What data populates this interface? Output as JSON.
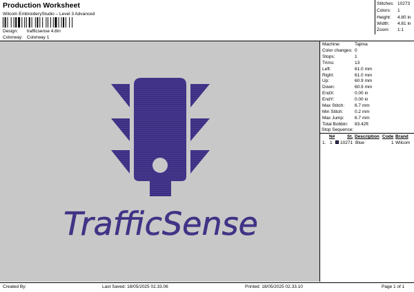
{
  "header": {
    "title": "Production Worksheet",
    "subtitle": "Wilcom EmbroideryStudio – Level 3 Advanced",
    "design_label": "Design:",
    "design_value": "trafficsense 4.8in",
    "colorway_label": "Colorway:",
    "colorway_value": "Colorway 1"
  },
  "summary": {
    "stitches_label": "Stitches:",
    "stitches_value": "10273",
    "colors_label": "Colors:",
    "colors_value": "1",
    "height_label": "Height:",
    "height_value": "4.80 in",
    "width_label": "Width:",
    "width_value": "4.81 in",
    "zoom_label": "Zoom:",
    "zoom_value": "1:1"
  },
  "design_preview": {
    "logo_text": "TrafficSense",
    "thread_color": "#3d2f80"
  },
  "machine_info": [
    {
      "label": "Machine:",
      "value": "Tajima"
    },
    {
      "label": "Color changes:",
      "value": "0"
    },
    {
      "label": "Stops:",
      "value": "1"
    },
    {
      "label": "Trims:",
      "value": "13"
    },
    {
      "label": "Left:",
      "value": "61.0 mm"
    },
    {
      "label": "Right:",
      "value": "61.0 mm"
    },
    {
      "label": "Up:",
      "value": "60.9 mm"
    },
    {
      "label": "Down:",
      "value": "60.9 mm"
    },
    {
      "label": "EndX:",
      "value": "0.00 in"
    },
    {
      "label": "EndY:",
      "value": "0.00 in"
    },
    {
      "label": "Max Stitch:",
      "value": "6.7 mm"
    },
    {
      "label": "Min Stitch:",
      "value": "0.2 mm"
    },
    {
      "label": "Max Jump:",
      "value": "6.7 mm"
    },
    {
      "label": "Total Bobbin:",
      "value": "83.42ft"
    }
  ],
  "stop_sequence": {
    "heading": "Stop Sequence:",
    "columns": [
      "N#",
      "St.",
      "Description",
      "Code",
      "Brand"
    ],
    "rows": [
      {
        "index": "1.",
        "n": "1",
        "stitches": "10271",
        "description": "Blue",
        "code": "1",
        "brand": "Wilcom"
      }
    ]
  },
  "footer": {
    "created_by": "Created By:",
    "last_saved": "Last Saved: 18/05/2025 02.33.06",
    "printed": "Printed: 18/05/2025 02.33.10",
    "page": "Page 1 of 1"
  }
}
